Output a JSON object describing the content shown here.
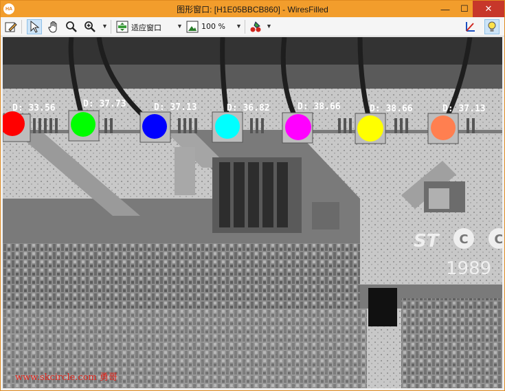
{
  "window": {
    "title": "图形窗口: [H1E05BBCB860] - WiresFilled",
    "app_icon_text": "HA",
    "minimize": "—",
    "maximize": "☐",
    "close": "✕"
  },
  "toolbar": {
    "fit_label": "适应窗口",
    "zoom_label": "100 %"
  },
  "wires": [
    {
      "label": "D: 33.56",
      "color": "#ff0000"
    },
    {
      "label": "D: 37.73",
      "color": "#00ff00"
    },
    {
      "label": "D: 37.13",
      "color": "#0000ff"
    },
    {
      "label": "D: 36.82",
      "color": "#00ffff"
    },
    {
      "label": "D: 38.66",
      "color": "#ff00ff"
    },
    {
      "label": "D: 38.66",
      "color": "#ffff00"
    },
    {
      "label": "D: 37.13",
      "color": "#ff7f50"
    }
  ],
  "chip": {
    "logo": "ST",
    "marking_letters": [
      "C",
      "C"
    ],
    "year": "1989"
  },
  "watermark": "www.skcircle.com 勇哥"
}
